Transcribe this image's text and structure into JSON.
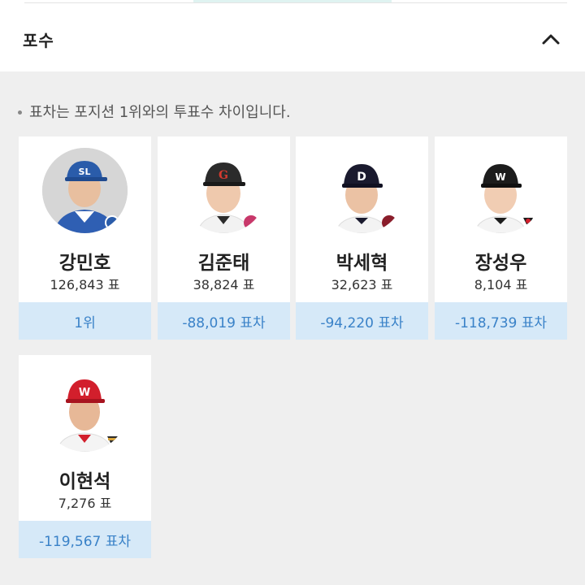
{
  "section": {
    "title": "포수",
    "collapse_icon": "chevron-up-icon"
  },
  "notice": "표차는 포지션 1위와의 투표수 차이입니다.",
  "players": [
    {
      "name": "강민호",
      "votes": "126,843 표",
      "gap": "1위",
      "cap_color": "#2a5caa",
      "cap_letter": "SL"
    },
    {
      "name": "김준태",
      "votes": "38,824 표",
      "gap": "-88,019 표차",
      "cap_color": "#2b2b2b",
      "cap_letter": "G"
    },
    {
      "name": "박세혁",
      "votes": "32,623 표",
      "gap": "-94,220 표차",
      "cap_color": "#1a1a2e",
      "cap_letter": "D"
    },
    {
      "name": "장성우",
      "votes": "8,104 표",
      "gap": "-118,739 표차",
      "cap_color": "#1c1c1c",
      "cap_letter": "W"
    },
    {
      "name": "이현석",
      "votes": "7,276 표",
      "gap": "-119,567 표차",
      "cap_color": "#d21f2c",
      "cap_letter": "W"
    }
  ],
  "colors": {
    "gap_bar_bg": "#d6e9f8",
    "gap_text": "#3a82c8",
    "page_bg": "#efefef"
  }
}
